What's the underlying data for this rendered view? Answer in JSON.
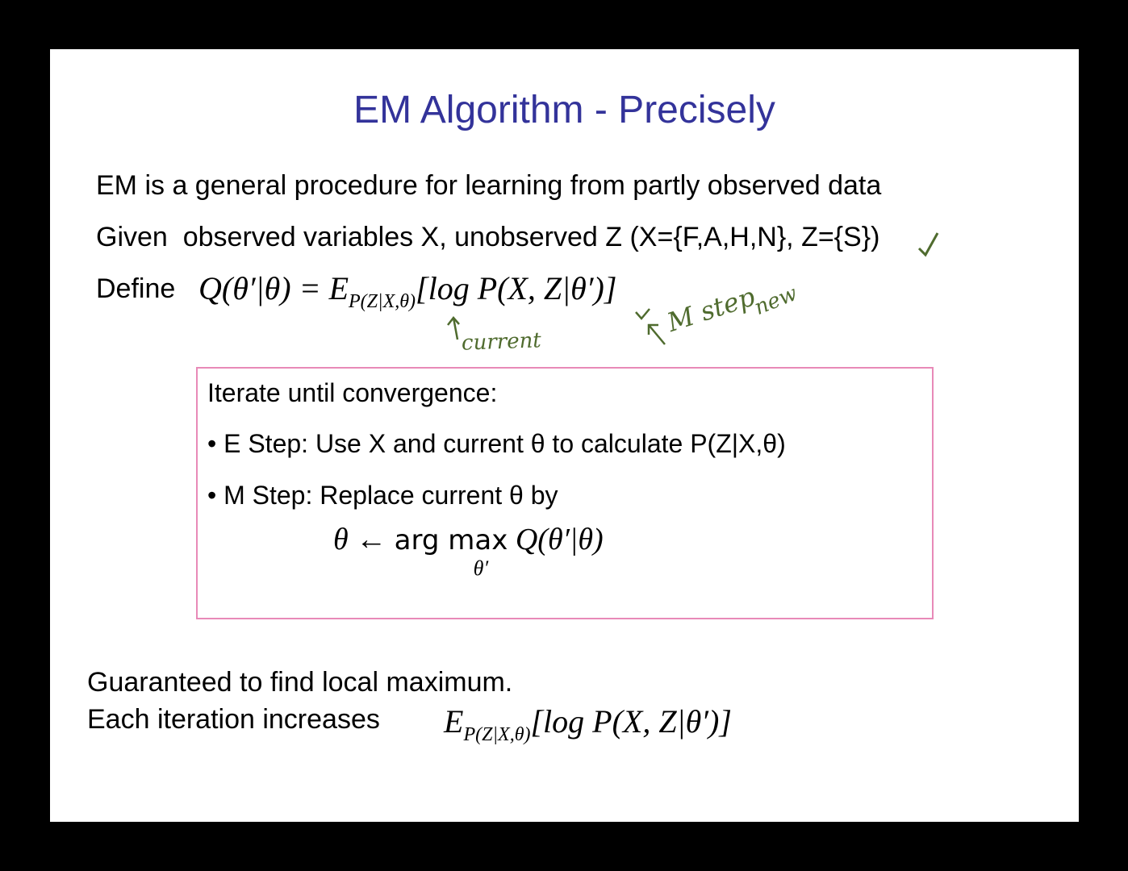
{
  "slide": {
    "title": "EM Algorithm - Precisely",
    "line1": "EM is a general procedure for learning from partly observed data",
    "line2_prefix": "Given",
    "line2_text": "observed variables X, unobserved Z  (X={F,A,H,N}, Z={S})",
    "define_label": "Define",
    "define_formula": {
      "lhs": "Q(θ′|θ) = E",
      "sub": "P(Z|X,θ)",
      "rhs": "[log P(X, Z|θ′)]"
    },
    "annotations": {
      "current": "current",
      "mstep": "M step",
      "new": "new"
    },
    "box": {
      "heading": "Iterate until convergence:",
      "estep": "• E Step: Use X and current θ to calculate P(Z|X,θ)",
      "mstep": "• M Step: Replace current θ by",
      "update_lhs": "θ ← ",
      "update_op": "arg max",
      "update_sub": "θ′",
      "update_rhs": " Q(θ′|θ)"
    },
    "bottom1": "Guaranteed to find local maximum.",
    "bottom2": "Each iteration increases",
    "bottom_formula": {
      "e": "E",
      "sub": "P(Z|X,θ)",
      "rhs": "[log P(X, Z|θ′)]"
    }
  },
  "colors": {
    "title": "#33339a",
    "box_border": "#e88ab8",
    "ink": "#4f6b2e"
  }
}
